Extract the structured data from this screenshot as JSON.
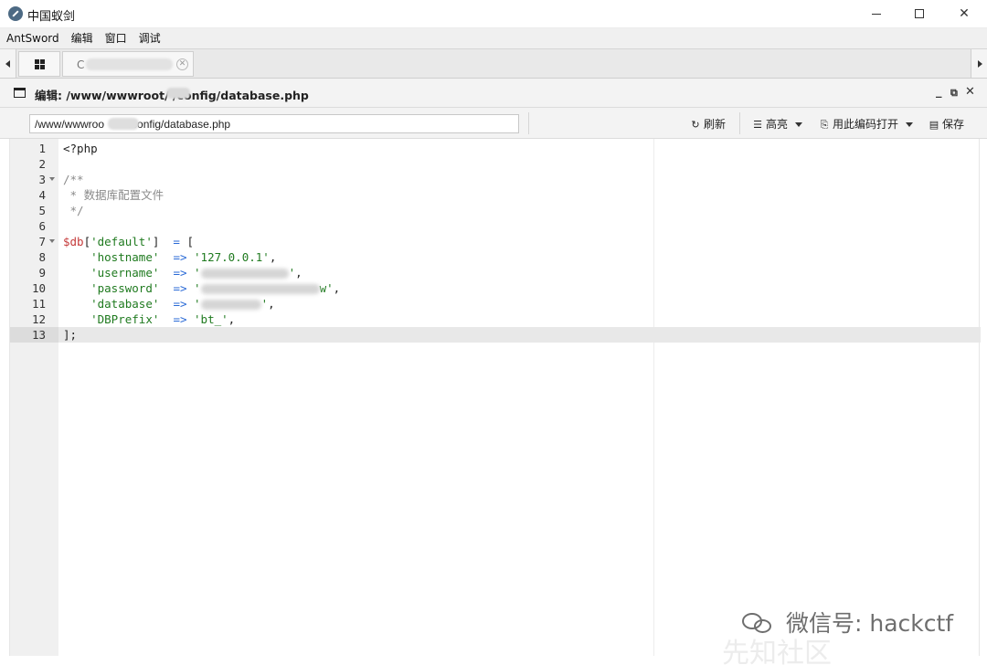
{
  "window": {
    "title": "中国蚁剑",
    "minimize_label": "–",
    "close_label": "✕"
  },
  "menu": {
    "items": [
      "AntSword",
      "编辑",
      "窗口",
      "调试"
    ]
  },
  "tabs": {
    "shell_label": "C",
    "close_label": "✕"
  },
  "editor": {
    "title": "编辑: /www/wwwroot/   /config/database.php",
    "controls": {
      "minimize": "_",
      "restore": "⧉",
      "close": "✕"
    }
  },
  "toolbar": {
    "path_value": "/www/wwwroo        /config/database.php",
    "refresh_icon": "↻",
    "refresh_label": "刷新",
    "highlight_icon": "☰",
    "highlight_label": "高亮",
    "encoding_icon": "⎘",
    "encoding_label": "用此编码打开",
    "save_icon": "▤",
    "save_label": "保存"
  },
  "code": {
    "active_line": 13,
    "lines": [
      {
        "n": "1",
        "parts": [
          [
            "plain",
            "<?php"
          ]
        ]
      },
      {
        "n": "2",
        "parts": []
      },
      {
        "n": "3",
        "fold": true,
        "parts": [
          [
            "comment",
            "/**"
          ]
        ]
      },
      {
        "n": "4",
        "parts": [
          [
            "comment",
            " * 数据库配置文件"
          ]
        ]
      },
      {
        "n": "5",
        "parts": [
          [
            "comment",
            " */"
          ]
        ]
      },
      {
        "n": "6",
        "parts": []
      },
      {
        "n": "7",
        "fold": true,
        "parts": [
          [
            "var",
            "$db"
          ],
          [
            "plain",
            "["
          ],
          [
            "str",
            "'default'"
          ],
          [
            "plain",
            "]  "
          ],
          [
            "op",
            "="
          ],
          [
            "plain",
            " ["
          ]
        ]
      },
      {
        "n": "8",
        "parts": [
          [
            "plain",
            "    "
          ],
          [
            "str",
            "'hostname'"
          ],
          [
            "plain",
            "  "
          ],
          [
            "op",
            "=>"
          ],
          [
            "plain",
            " "
          ],
          [
            "str",
            "'127.0.0.1'"
          ],
          [
            "plain",
            ","
          ]
        ]
      },
      {
        "n": "9",
        "parts": [
          [
            "plain",
            "    "
          ],
          [
            "str",
            "'username'"
          ],
          [
            "plain",
            "  "
          ],
          [
            "op",
            "=>"
          ],
          [
            "plain",
            " "
          ],
          [
            "str",
            "'"
          ],
          [
            "blur",
            "96"
          ],
          [
            "str",
            "'"
          ],
          [
            "plain",
            ","
          ]
        ]
      },
      {
        "n": "10",
        "parts": [
          [
            "plain",
            "    "
          ],
          [
            "str",
            "'password'"
          ],
          [
            "plain",
            "  "
          ],
          [
            "op",
            "=>"
          ],
          [
            "plain",
            " "
          ],
          [
            "str",
            "'"
          ],
          [
            "blur",
            "130"
          ],
          [
            "str",
            "w'"
          ],
          [
            "plain",
            ","
          ]
        ]
      },
      {
        "n": "11",
        "parts": [
          [
            "plain",
            "    "
          ],
          [
            "str",
            "'database'"
          ],
          [
            "plain",
            "  "
          ],
          [
            "op",
            "=>"
          ],
          [
            "plain",
            " "
          ],
          [
            "str",
            "'"
          ],
          [
            "blur",
            "66"
          ],
          [
            "str",
            "'"
          ],
          [
            "plain",
            ","
          ]
        ]
      },
      {
        "n": "12",
        "parts": [
          [
            "plain",
            "    "
          ],
          [
            "str",
            "'DBPrefix'"
          ],
          [
            "plain",
            "  "
          ],
          [
            "op",
            "=>"
          ],
          [
            "plain",
            " "
          ],
          [
            "str",
            "'bt_'"
          ],
          [
            "plain",
            ","
          ]
        ]
      },
      {
        "n": "13",
        "parts": [
          [
            "plain",
            "];"
          ]
        ]
      }
    ]
  },
  "watermark": {
    "text": "微信号: hackctf",
    "bg_text": "先知社区"
  },
  "colors": {
    "comment": "#8a8a8a",
    "variable": "#c53a3a",
    "string": "#1f7a1f",
    "operator": "#2a6ad6",
    "gutter": "#f0f0f0",
    "active_line": "#e8e8e8"
  }
}
